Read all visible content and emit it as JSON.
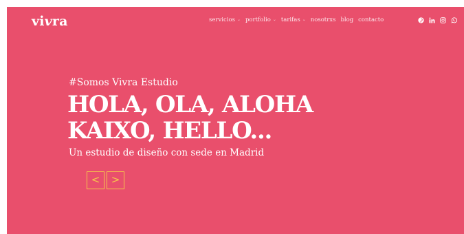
{
  "brand": {
    "logo_prefix": "vi",
    "logo_italic": "v",
    "logo_suffix": "ra"
  },
  "nav": {
    "items": [
      {
        "label": "servicios",
        "has_dropdown": true
      },
      {
        "label": "portfolio",
        "has_dropdown": true
      },
      {
        "label": "tarifas",
        "has_dropdown": true
      },
      {
        "label": "nosotrxs",
        "has_dropdown": false
      },
      {
        "label": "blog",
        "has_dropdown": false
      },
      {
        "label": "contacto",
        "has_dropdown": false
      }
    ],
    "dropdown_glyph": "⌄"
  },
  "socials": [
    "pinterest-icon",
    "linkedin-icon",
    "instagram-icon",
    "whatsapp-icon"
  ],
  "hero": {
    "kicker": "#Somos Vivra Estudio",
    "title_line1": "HOLA, OLA, ALOHA",
    "title_line2": "KAIXO, HELLO...",
    "subtitle": "Un estudio de diseño con sede en Madrid",
    "prev_label": "<",
    "next_label": ">"
  },
  "colors": {
    "background": "#e94f6c",
    "text": "#ffffff",
    "accent": "#f6c84b"
  }
}
